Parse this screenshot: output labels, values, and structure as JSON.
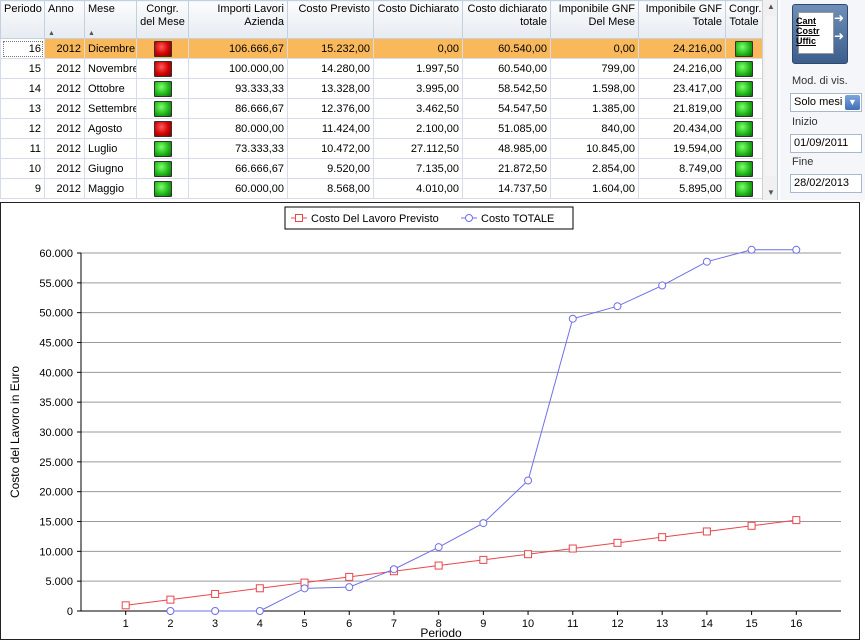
{
  "table": {
    "columns": [
      {
        "key": "periodo",
        "label": "Periodo",
        "sortable": false
      },
      {
        "key": "anno",
        "label": "Anno",
        "sortable": true
      },
      {
        "key": "mese",
        "label": "Mese",
        "sortable": true
      },
      {
        "key": "congr_mese",
        "label": "Congr. del Mese",
        "sortable": false
      },
      {
        "key": "importi",
        "label": "Importi Lavori Azienda",
        "sortable": false
      },
      {
        "key": "costo_prev",
        "label": "Costo Previsto",
        "sortable": false
      },
      {
        "key": "costo_dich",
        "label": "Costo Dichiarato",
        "sortable": false
      },
      {
        "key": "costo_dich_tot",
        "label": "Costo dichiarato totale",
        "sortable": false
      },
      {
        "key": "imp_gnf_mese",
        "label": "Imponibile GNF Del Mese",
        "sortable": false
      },
      {
        "key": "imp_gnf_tot",
        "label": "Imponibile GNF Totale",
        "sortable": false
      },
      {
        "key": "congr_tot",
        "label": "Congr. Totale",
        "sortable": false
      }
    ],
    "rows": [
      {
        "periodo": "16",
        "anno": "2012",
        "mese": "Dicembre",
        "congr_mese": "red",
        "importi": "106.666,67",
        "costo_prev": "15.232,00",
        "costo_dich": "0,00",
        "costo_dich_tot": "60.540,00",
        "imp_gnf_mese": "0,00",
        "imp_gnf_tot": "24.216,00",
        "congr_tot": "green",
        "selected": true
      },
      {
        "periodo": "15",
        "anno": "2012",
        "mese": "Novembre",
        "congr_mese": "red",
        "importi": "100.000,00",
        "costo_prev": "14.280,00",
        "costo_dich": "1.997,50",
        "costo_dich_tot": "60.540,00",
        "imp_gnf_mese": "799,00",
        "imp_gnf_tot": "24.216,00",
        "congr_tot": "green"
      },
      {
        "periodo": "14",
        "anno": "2012",
        "mese": "Ottobre",
        "congr_mese": "green",
        "importi": "93.333,33",
        "costo_prev": "13.328,00",
        "costo_dich": "3.995,00",
        "costo_dich_tot": "58.542,50",
        "imp_gnf_mese": "1.598,00",
        "imp_gnf_tot": "23.417,00",
        "congr_tot": "green"
      },
      {
        "periodo": "13",
        "anno": "2012",
        "mese": "Settembre",
        "congr_mese": "green",
        "importi": "86.666,67",
        "costo_prev": "12.376,00",
        "costo_dich": "3.462,50",
        "costo_dich_tot": "54.547,50",
        "imp_gnf_mese": "1.385,00",
        "imp_gnf_tot": "21.819,00",
        "congr_tot": "green"
      },
      {
        "periodo": "12",
        "anno": "2012",
        "mese": "Agosto",
        "congr_mese": "red",
        "importi": "80.000,00",
        "costo_prev": "11.424,00",
        "costo_dich": "2.100,00",
        "costo_dich_tot": "51.085,00",
        "imp_gnf_mese": "840,00",
        "imp_gnf_tot": "20.434,00",
        "congr_tot": "green"
      },
      {
        "periodo": "11",
        "anno": "2012",
        "mese": "Luglio",
        "congr_mese": "green",
        "importi": "73.333,33",
        "costo_prev": "10.472,00",
        "costo_dich": "27.112,50",
        "costo_dich_tot": "48.985,00",
        "imp_gnf_mese": "10.845,00",
        "imp_gnf_tot": "19.594,00",
        "congr_tot": "green"
      },
      {
        "periodo": "10",
        "anno": "2012",
        "mese": "Giugno",
        "congr_mese": "green",
        "importi": "66.666,67",
        "costo_prev": "9.520,00",
        "costo_dich": "7.135,00",
        "costo_dich_tot": "21.872,50",
        "imp_gnf_mese": "2.854,00",
        "imp_gnf_tot": "8.749,00",
        "congr_tot": "green"
      },
      {
        "periodo": "9",
        "anno": "2012",
        "mese": "Maggio",
        "congr_mese": "green",
        "importi": "60.000,00",
        "costo_prev": "8.568,00",
        "costo_dich": "4.010,00",
        "costo_dich_tot": "14.737,50",
        "imp_gnf_mese": "1.604,00",
        "imp_gnf_tot": "5.895,00",
        "congr_tot": "green"
      }
    ]
  },
  "side": {
    "logo_lines": [
      "Cant",
      "Costr",
      "Uffic"
    ],
    "mode_label": "Mod. di vis.",
    "mode_value": "Solo mesi fi",
    "start_label": "Inizio",
    "start_value": "01/09/2011",
    "end_label": "Fine",
    "end_value": "28/02/2013"
  },
  "colors": {
    "selected_row": "#f9b95b",
    "series_previsto": "#e8474d",
    "series_totale": "#6f6fe8",
    "light_red": "#d10000",
    "light_green": "#22b81c"
  },
  "chart_data": {
    "type": "line",
    "xlabel": "Periodo",
    "ylabel": "Costo del Lavoro in Euro",
    "ylim": [
      0,
      60000
    ],
    "yticks": [
      0,
      5000,
      10000,
      15000,
      20000,
      25000,
      30000,
      35000,
      40000,
      45000,
      50000,
      55000,
      60000
    ],
    "ytick_labels": [
      "0",
      "5.000",
      "10.000",
      "15.000",
      "20.000",
      "25.000",
      "30.000",
      "35.000",
      "40.000",
      "45.000",
      "50.000",
      "55.000",
      "60.000"
    ],
    "xlim": [
      0,
      17
    ],
    "x": [
      1,
      2,
      3,
      4,
      5,
      6,
      7,
      8,
      9,
      10,
      11,
      12,
      13,
      14,
      15,
      16
    ],
    "legend_position": "top-center",
    "grid": true,
    "series": [
      {
        "name": "Costo Del Lavoro Previsto",
        "marker": "square",
        "color": "#e8474d",
        "values": [
          952,
          1904,
          2856,
          3808,
          4760,
          5712,
          6664,
          7616,
          8568,
          9520,
          10472,
          11424,
          12376,
          13328,
          14280,
          15232
        ]
      },
      {
        "name": "Costo TOTALE",
        "marker": "circle",
        "color": "#6f6fe8",
        "values": [
          null,
          0,
          0,
          0,
          3800,
          4000,
          7000,
          10700,
          14737.5,
          21872.5,
          48985,
          51085,
          54547.5,
          58542.5,
          60540,
          60540
        ]
      }
    ]
  }
}
